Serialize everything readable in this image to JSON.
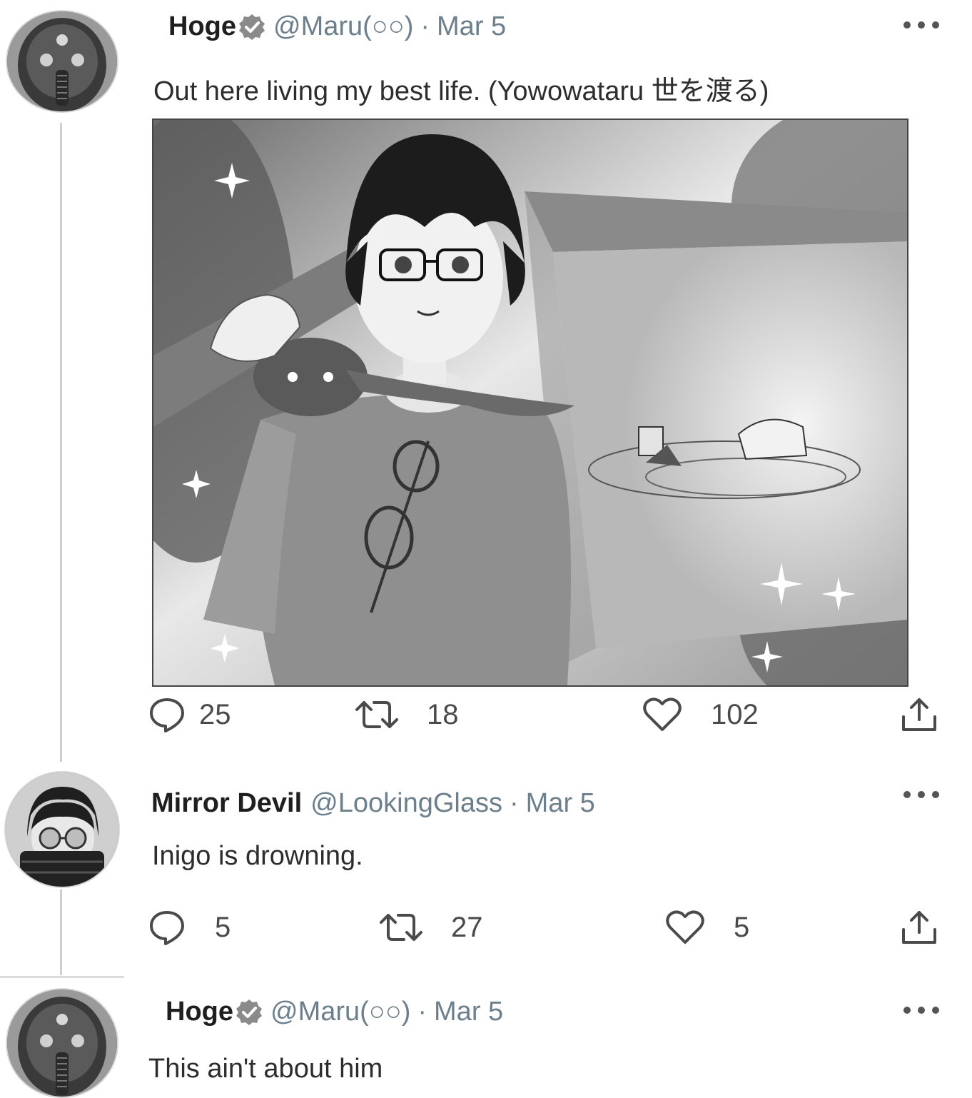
{
  "tweets": [
    {
      "name": "Hoge",
      "handle": "@Maru(○○)",
      "separator": "·",
      "date": "Mar 5",
      "text": "Out here living my best life. (Yowowataru 世を渡る)",
      "stats": {
        "replies": "25",
        "retweets": "18",
        "likes": "102"
      },
      "avatar": "mechanical-mask-avatar",
      "verified": true
    },
    {
      "name": "Mirror Devil",
      "handle": "@LookingGlass",
      "separator": "·",
      "date": "Mar 5",
      "text": "Inigo is drowning.",
      "stats": {
        "replies": "5",
        "retweets": "27",
        "likes": "5"
      },
      "avatar": "glasses-masked-person-avatar",
      "verified": false
    },
    {
      "name": "Hoge",
      "handle": "@Maru(○○)",
      "separator": "·",
      "date": "Mar 5",
      "text": "This ain't about him",
      "avatar": "mechanical-mask-avatar",
      "verified": true
    }
  ],
  "icons": {
    "reply": "speech-bubble-icon",
    "retweet": "retweet-arrows-icon",
    "like": "heart-icon",
    "share": "share-upload-icon",
    "more": "ellipsis-icon",
    "verified": "verified-badge-icon"
  },
  "colors": {
    "handle": "#6c7f8c",
    "thread_line": "#cfcfcf",
    "text": "#2d2d2d"
  }
}
